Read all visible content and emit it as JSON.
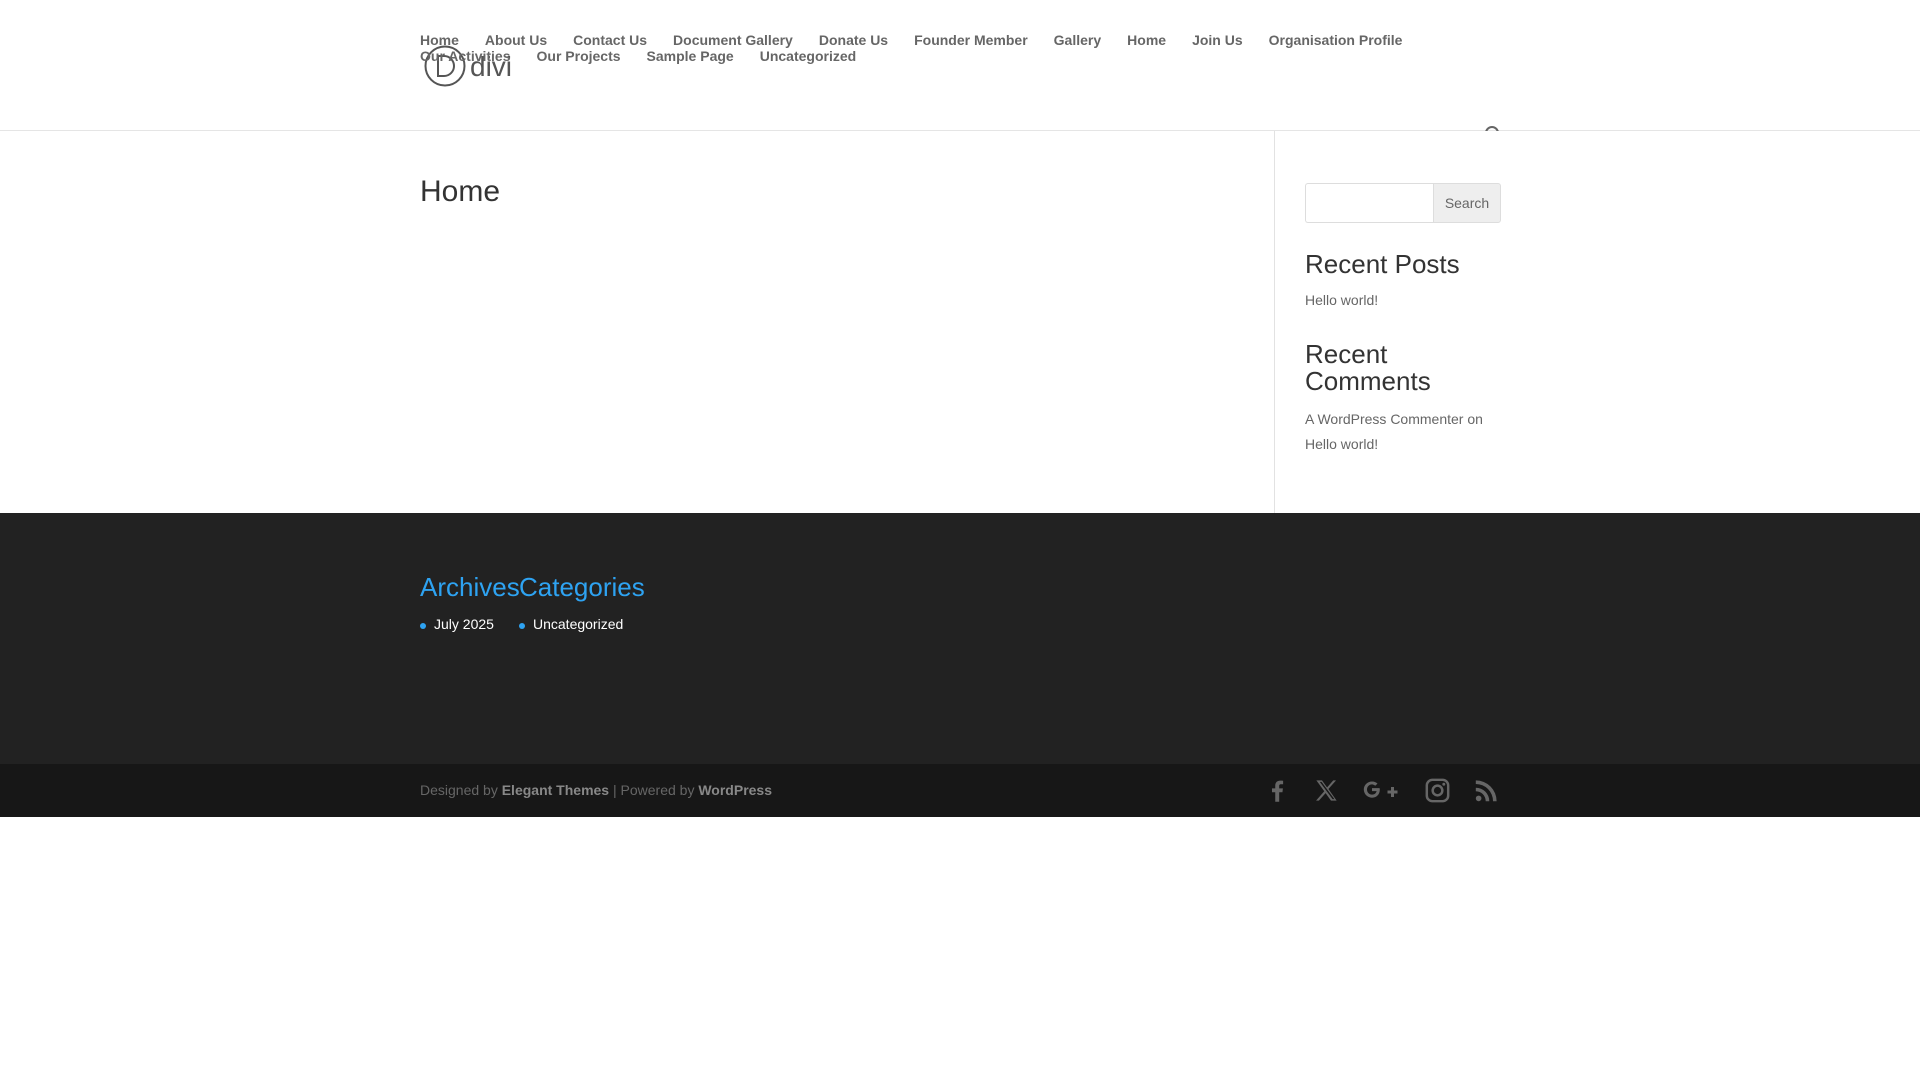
{
  "header": {
    "logo_text": "divi",
    "nav_row1": [
      "Home",
      "About Us",
      "Contact Us",
      "Document Gallery",
      "Donate Us",
      "Founder Member",
      "Gallery",
      "Home",
      "Join Us",
      "Organisation Profile"
    ],
    "nav_row2": [
      "Our Activities",
      "Our Projects",
      "Sample Page",
      "Uncategorized"
    ]
  },
  "main": {
    "page_title": "Home"
  },
  "sidebar": {
    "search_button": "Search",
    "search_value": "",
    "recent_posts_title": "Recent Posts",
    "recent_posts": [
      "Hello world!"
    ],
    "recent_comments_title": "Recent Comments",
    "recent_comment": {
      "author": "A WordPress Commenter",
      "joiner": " on ",
      "post": "Hello world!"
    }
  },
  "footer": {
    "archives_title": "Archives",
    "archives": [
      "July 2025"
    ],
    "categories_title": "Categories",
    "categories": [
      "Uncategorized"
    ]
  },
  "bottom_bar": {
    "designed_by": "Designed by ",
    "elegant_themes": "Elegant Themes",
    "separator": " | Powered by ",
    "wordpress": "WordPress",
    "social_icons": [
      "facebook-icon",
      "x-twitter-icon",
      "google-plus-icon",
      "instagram-icon",
      "rss-icon"
    ]
  },
  "colors": {
    "accent": "#2ea3f2",
    "footer_bg": "#222222",
    "bottom_bar_bg": "#171717",
    "nav_text": "#666666"
  }
}
